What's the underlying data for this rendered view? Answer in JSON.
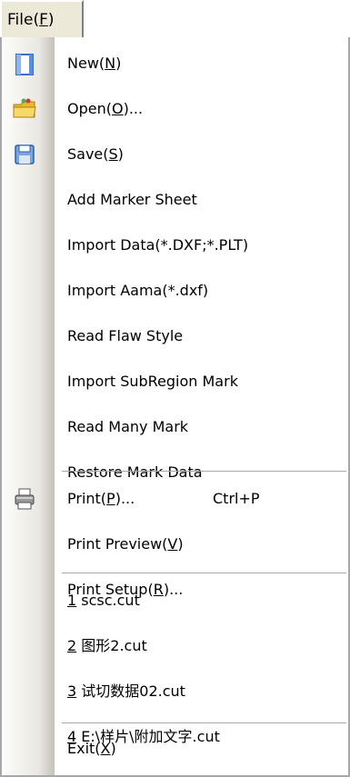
{
  "menubar": {
    "file_pre": "File(",
    "file_key": "F",
    "file_post": ")"
  },
  "menu": {
    "new": {
      "pre": "New(",
      "key": "N",
      "post": ")",
      "icon": "new-document-icon"
    },
    "open": {
      "pre": "Open(",
      "key": "O",
      "post": ")...",
      "icon": "folder-icon"
    },
    "save": {
      "pre": "Save(",
      "key": "S",
      "post": ")",
      "icon": "floppy-disk-icon"
    },
    "add_marker_sheet": "Add Marker Sheet",
    "import_data": "Import Data(*.DXF;*.PLT)",
    "import_aama": "Import Aama(*.dxf)",
    "read_flaw_style": "Read Flaw Style",
    "import_subregion_mark": "Import SubRegion Mark",
    "read_many_mark": "Read Many Mark",
    "restore_mark_data": "Restore Mark Data",
    "print": {
      "pre": "Print(",
      "key": "P",
      "post": ")...",
      "shortcut": "Ctrl+P",
      "icon": "printer-icon"
    },
    "print_preview": {
      "pre": "Print Preview(",
      "key": "V",
      "post": ")"
    },
    "print_setup": {
      "pre": "Print Setup(",
      "key": "R",
      "post": ")..."
    },
    "recent": [
      {
        "key": "1",
        "name": " scsc.cut"
      },
      {
        "key": "2",
        "name": " 图形2.cut"
      },
      {
        "key": "3",
        "name": " 试切数据02.cut"
      },
      {
        "key": "4",
        "name": " E:\\样片\\附加文字.cut"
      }
    ],
    "exit": {
      "pre": "Exit(",
      "key": "X",
      "post": ")"
    }
  }
}
